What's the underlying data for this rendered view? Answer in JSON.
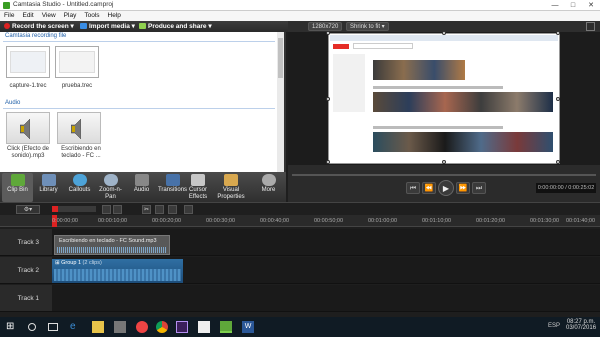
{
  "window": {
    "title": "Camtasia Studio - Untitled.camproj"
  },
  "menu": [
    "File",
    "Edit",
    "View",
    "Play",
    "Tools",
    "Help"
  ],
  "toolbar": {
    "record": "Record the screen",
    "import": "Import media",
    "produce": "Produce and share"
  },
  "clipbin": {
    "recording_section": "Camtasia recording file",
    "recordings": [
      {
        "label": "capture-1.trec"
      },
      {
        "label": "prueba.trec"
      }
    ],
    "audio_section": "Audio",
    "audio": [
      {
        "label": "Click (Efecto de sonido).mp3"
      },
      {
        "label": "Escribiendo en teclado - FC ..."
      }
    ]
  },
  "preview": {
    "size": "1280x720",
    "shrink": "Shrink to fit"
  },
  "tasks": [
    {
      "label": "Clip Bin",
      "icon": "clip-bin-icon"
    },
    {
      "label": "Library",
      "icon": "library-icon"
    },
    {
      "label": "Callouts",
      "icon": "callouts-icon"
    },
    {
      "label": "Zoom-n-Pan",
      "icon": "zoom-icon"
    },
    {
      "label": "Audio",
      "icon": "audio-icon"
    },
    {
      "label": "Transitions",
      "icon": "transitions-icon"
    },
    {
      "label": "Cursor Effects",
      "icon": "cursor-icon"
    },
    {
      "label": "Visual Properties",
      "icon": "visual-properties-icon"
    },
    {
      "label": "More",
      "icon": "more-icon"
    }
  ],
  "player": {
    "time": "0:00:00:00 / 0:00:25:02"
  },
  "timeline": {
    "ticks": [
      "0:00:00;00",
      "00:00:10;00",
      "00:00:20;00",
      "00:00:30;00",
      "00:00:40;00",
      "00:00:50;00",
      "00:01:00;00",
      "00:01:10;00",
      "00:01:20;00",
      "00:01:30;00",
      "00:01:40;00"
    ],
    "tracks": [
      {
        "label": "Track 3",
        "clip": "Escribiendo en teclado - FC Sound.mp3"
      },
      {
        "label": "Track 2",
        "clip": "Group 1",
        "clip_sub": "(2 clips)"
      },
      {
        "label": "Track 1",
        "clip": ""
      }
    ]
  },
  "taskbar": {
    "lang": "ESP",
    "time": "08:27 p.m.",
    "date": "03/07/2016"
  }
}
